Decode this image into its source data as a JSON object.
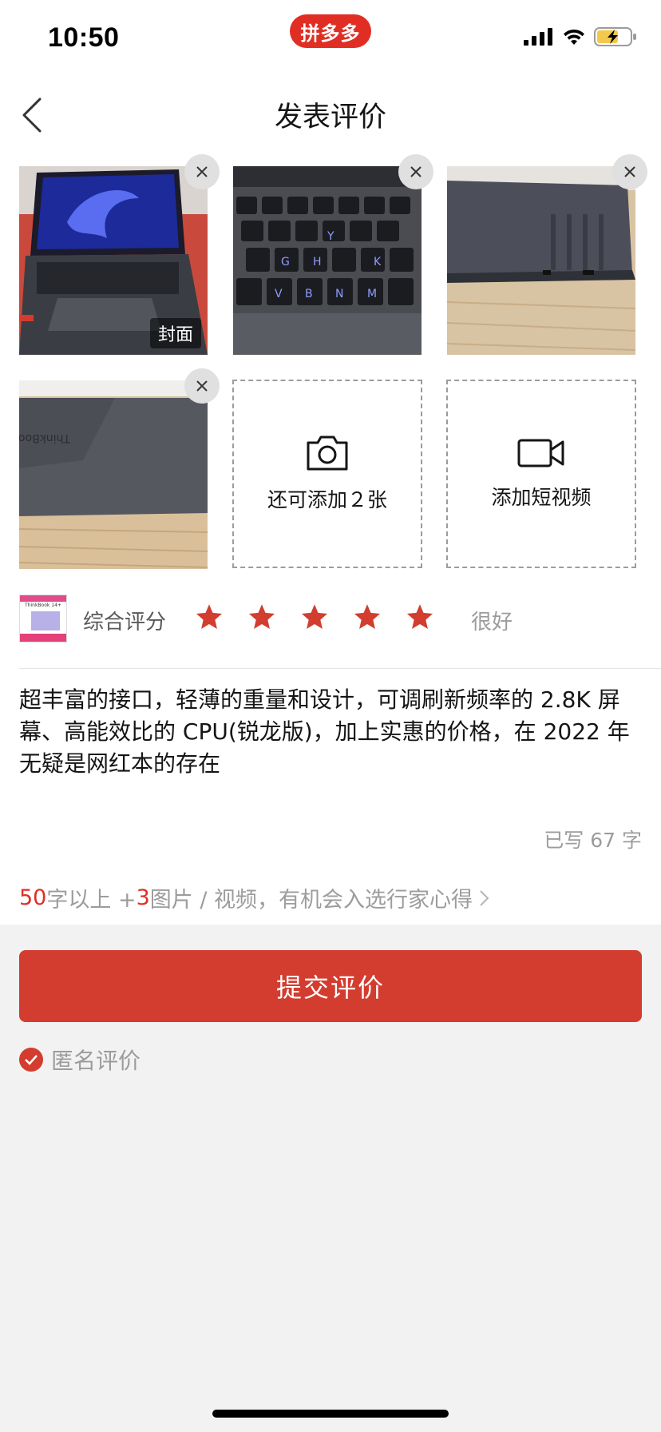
{
  "status_bar": {
    "time": "10:50",
    "app_badge": "拼多多"
  },
  "header": {
    "title": "发表评价"
  },
  "photos": [
    {
      "id": "photo-1",
      "cover_label": "封面",
      "depicts": "laptop-open"
    },
    {
      "id": "photo-2",
      "depicts": "keyboard"
    },
    {
      "id": "photo-3",
      "depicts": "laptop-bottom"
    },
    {
      "id": "photo-4",
      "depicts": "laptop-lid"
    }
  ],
  "add_photo": {
    "label": "还可添加２张"
  },
  "add_video": {
    "label": "添加短视频"
  },
  "rating": {
    "label": "综合评分",
    "stars": 5,
    "max": 5,
    "text": "很好"
  },
  "review": {
    "text": "超丰富的接口，轻薄的重量和设计，可调刷新频率的 2.8K 屏幕、高能效比的 CPU(锐龙版)，加上实惠的价格，在 2022 年无疑是网红本的存在"
  },
  "count": {
    "text": "已写 67 字"
  },
  "tip": {
    "num1": "50",
    "part1": "字以上 +",
    "num2": "3",
    "part2": "图片 / 视频，有机会入选行家心得"
  },
  "submit": {
    "label": "提交评价"
  },
  "anonymous": {
    "label": "匿名评价",
    "checked": true
  },
  "colors": {
    "accent": "#d23d2f",
    "brand": "#e02e24",
    "muted": "#9c9c9c"
  }
}
